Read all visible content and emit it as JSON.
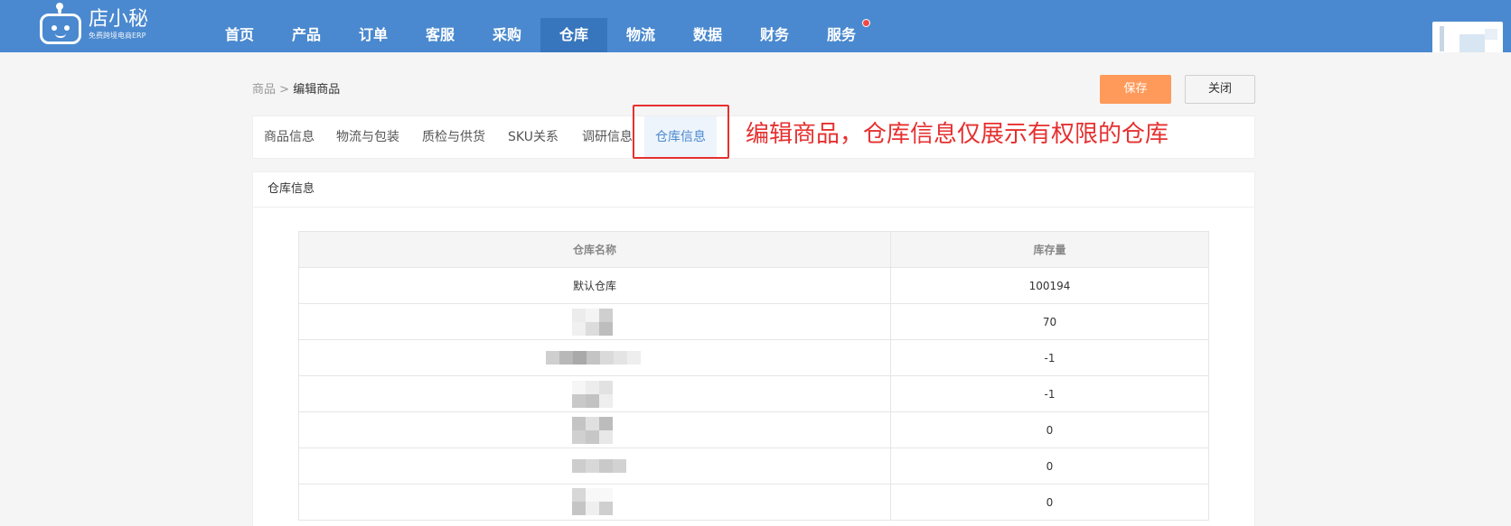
{
  "app": {
    "logo_name": "店小秘",
    "logo_sub": "免费跨境电商ERP"
  },
  "nav": {
    "items": [
      {
        "label": "首页"
      },
      {
        "label": "产品"
      },
      {
        "label": "订单"
      },
      {
        "label": "客服"
      },
      {
        "label": "采购"
      },
      {
        "label": "仓库",
        "active": true
      },
      {
        "label": "物流"
      },
      {
        "label": "数据"
      },
      {
        "label": "财务"
      },
      {
        "label": "服务",
        "badge_dot": true
      }
    ]
  },
  "breadcrumb": {
    "root": "商品",
    "separator": " > ",
    "current": "编辑商品"
  },
  "actions": {
    "save_label": "保存",
    "close_label": "关闭"
  },
  "tabs": [
    {
      "label": "商品信息"
    },
    {
      "label": "物流与包装"
    },
    {
      "label": "质检与供货"
    },
    {
      "label": "SKU关系"
    },
    {
      "label": "调研信息"
    },
    {
      "label": "仓库信息",
      "active": true
    }
  ],
  "annotation": {
    "text": "编辑商品，仓库信息仅展示有权限的仓库",
    "color": "#e63030"
  },
  "panel": {
    "title": "仓库信息"
  },
  "warehouse_table": {
    "headers": [
      "仓库名称",
      "库存量"
    ],
    "rows": [
      {
        "name": "默认仓库",
        "stock": "100194"
      },
      {
        "name": "",
        "stock": "70",
        "name_pixelated": true
      },
      {
        "name": "",
        "stock": "-1",
        "name_pixelated": true
      },
      {
        "name": "",
        "stock": "-1",
        "name_pixelated": true
      },
      {
        "name": "",
        "stock": "0",
        "name_pixelated": true
      },
      {
        "name": "",
        "stock": "0",
        "name_pixelated": true
      },
      {
        "name": "",
        "stock": "0",
        "name_pixelated": true
      }
    ]
  },
  "colors": {
    "nav_bg": "#4a89cf",
    "nav_active": "#3776bc",
    "save_button": "#ff9a5a",
    "active_tab_text": "#4a89cf"
  }
}
